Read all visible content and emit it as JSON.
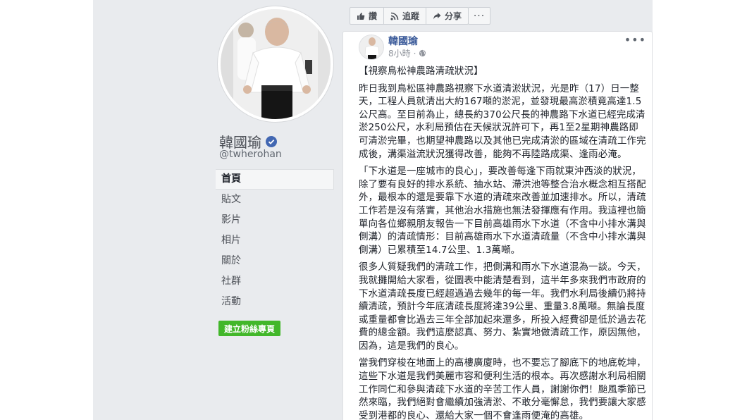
{
  "sidebar": {
    "page_name": "韓國瑜",
    "handle": "@twherohan",
    "nav_items": [
      "首頁",
      "貼文",
      "影片",
      "相片",
      "關於",
      "社群",
      "活動"
    ],
    "fan_button": "建立粉絲專頁"
  },
  "action_bar": {
    "like": "讚",
    "follow": "追蹤",
    "share": "分享",
    "more": "···"
  },
  "post": {
    "author": "韓國瑜",
    "time": "8小時",
    "options": "•••",
    "title": "【視察鳥松神農路清疏狀況】",
    "paragraphs": [
      "昨日我到鳥松區神農路視察下水道清淤狀況，光是昨（17）日一整天，工程人員就清出大約167噸的淤泥，並發現最高淤積竟高達1.5公尺高。至目前為止，總長約370公尺長的神農路下水道已經完成清淤250公尺，水利局預估在天候狀況許可下，再1至2星期神農路即可清淤完畢，也期望神農路以及其他已完成清淤的區域在清疏工作完成後，溝渠溢流狀況獲得改善，能夠不再陸路成渠、逢雨必淹。",
      "「下水道是一座城市的良心」，要改善每逢下雨就東沖西淡的狀況，除了要有良好的排水系統、抽水站、滯洪池等整合治水概念相互搭配外，最根本的還是要靠下水道的清疏來改善並加速排水。所以，清疏工作若是沒有落實，其他治水措施也無法發揮應有作用。我這裡也簡單向各位鄉親朋友報告一下目前高雄雨水下水道（不含中小排水溝與側溝）的清疏情形：目前高雄雨水下水道清疏量（不含中小排水溝與側溝）已累積至14.7公里、1.3萬噸。",
      "很多人質疑我們的清疏工作，把側溝和雨水下水道混為一談。今天，我就攤開給大家看，從圖表中能清楚看到，這半年多來我們市政府的下水道清疏長度已經超過過去幾年的每一年。我們水利局後續仍將持續清疏，預計今年底清疏長度將達39公里、重量3.8萬噸。無論長度或重量都會比過去三年全部加起來還多，所投入經費卻是低於過去花費的總金額。我們這麼認真、努力、紮實地做清疏工作，原因無他，因為，這是我們的良心。",
      "當我們穿梭在地面上的高樓廣廈時，也不要忘了腳底下的地底乾坤，這些下水道是我們美麗市容和便利生活的根本。再次感謝水利局相關工作同仁和參與清疏下水道的辛苦工作人員，謝謝你們！颱風季節已然來臨，我們絕對會繼續加強清淤、不敢分毫懈怠，我們要讓大家感受到港都的良心、還給大家一個不會逢雨便淹的高雄。"
    ]
  }
}
